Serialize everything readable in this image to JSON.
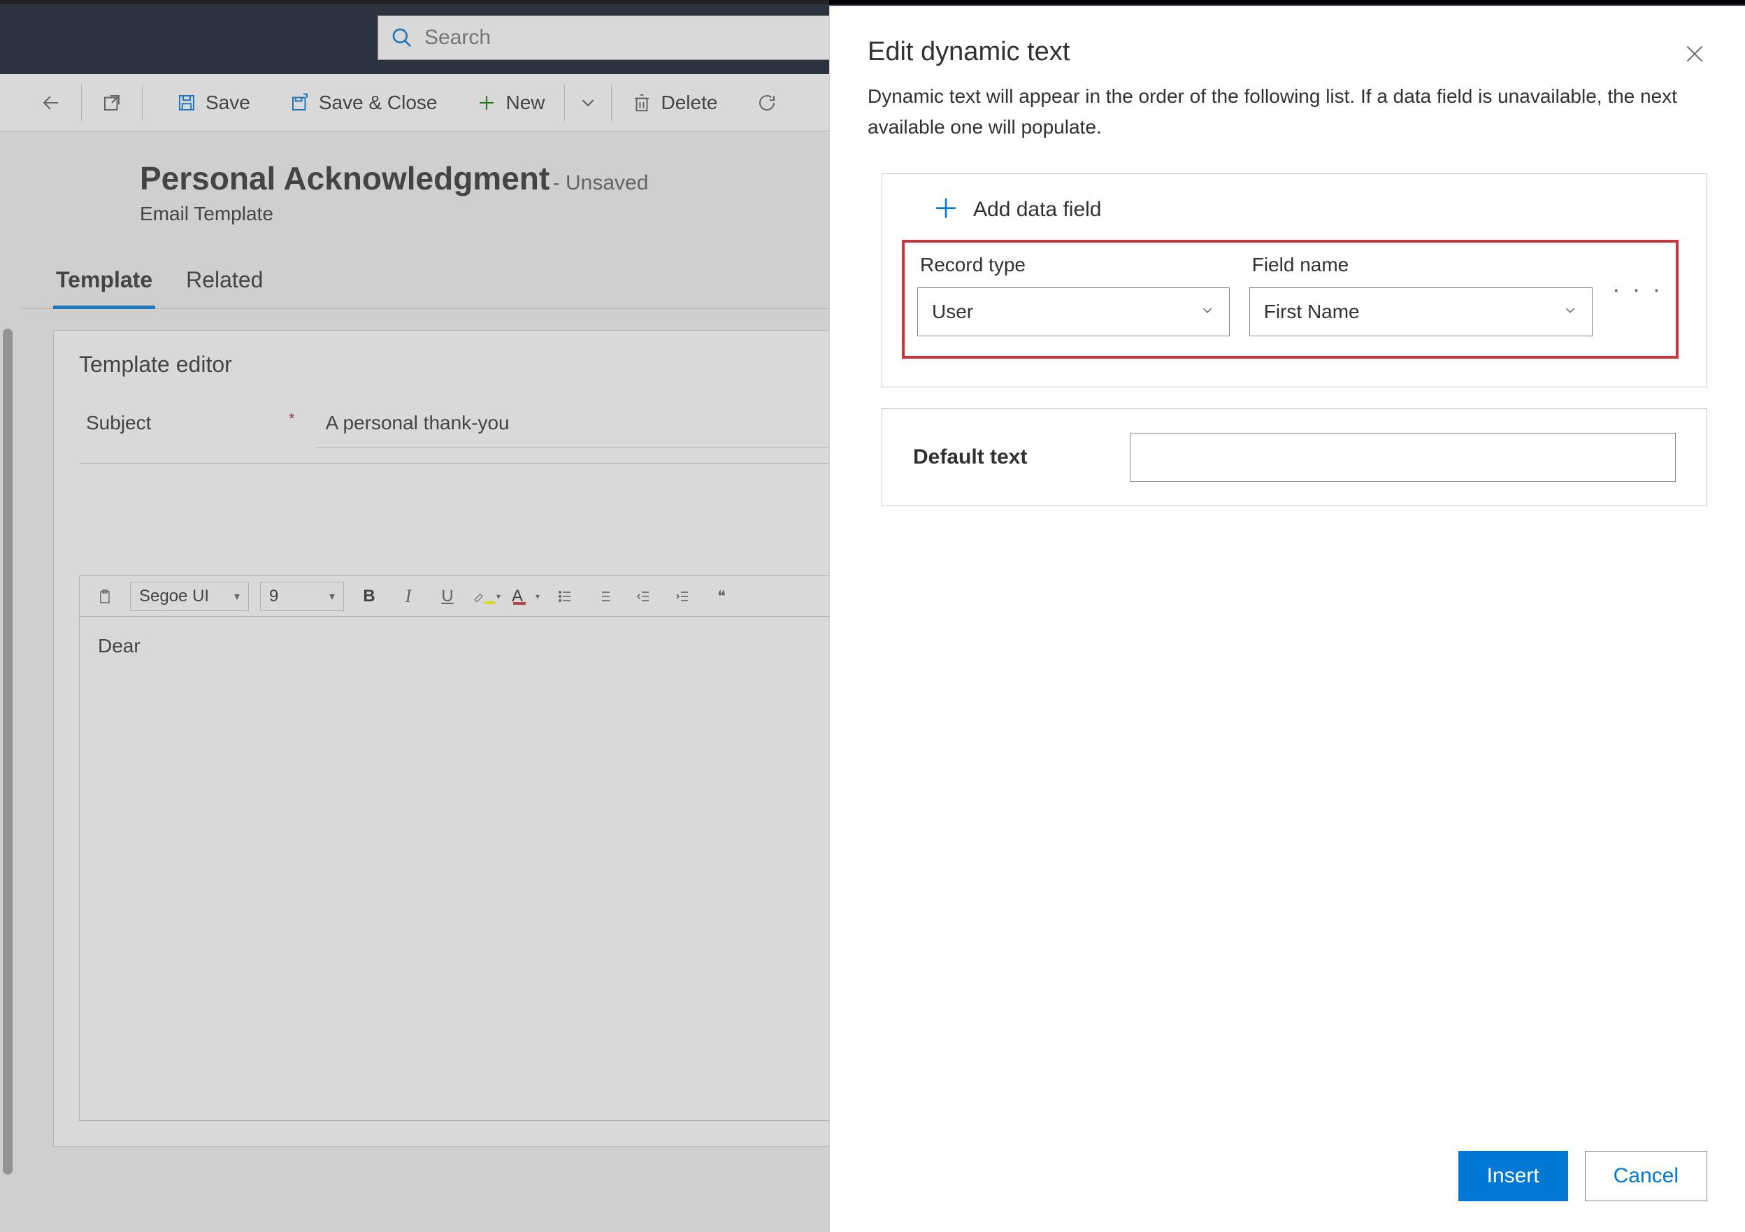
{
  "header": {
    "search_placeholder": "Search"
  },
  "commandbar": {
    "save": "Save",
    "save_close": "Save & Close",
    "new": "New",
    "delete": "Delete"
  },
  "page": {
    "title": "Personal Acknowledgment",
    "title_suffix": "- Unsaved",
    "subtitle": "Email Template",
    "tabs": {
      "template": "Template",
      "related": "Related"
    },
    "editor_heading": "Template editor",
    "subject_label": "Subject",
    "subject_value": "A personal thank-you",
    "rte": {
      "font": "Segoe UI",
      "size": "9",
      "body": "Dear"
    }
  },
  "flyout": {
    "title": "Edit dynamic text",
    "desc": "Dynamic text will appear in the order of the following list. If a data field is unavailable, the next available one will populate.",
    "add_field": "Add data field",
    "record_type_label": "Record type",
    "record_type_value": "User",
    "field_name_label": "Field name",
    "field_name_value": "First Name",
    "more": "· · ·",
    "default_text_label": "Default text",
    "default_text_value": "",
    "insert": "Insert",
    "cancel": "Cancel"
  }
}
